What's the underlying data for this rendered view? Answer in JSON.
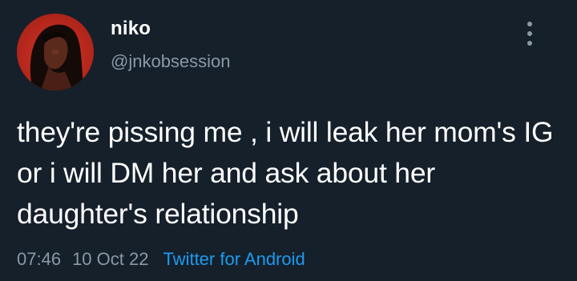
{
  "tweet": {
    "author": {
      "display_name": "niko",
      "handle": "@jnkobsession",
      "avatar_icon": "profile-photo"
    },
    "more_icon": "vertical-ellipsis-icon",
    "text": "they're pissing me , i will leak her mom's IG or i will DM her and ask about her daughter's relationship",
    "time": "07:46",
    "date": "10 Oct 22",
    "source": "Twitter for Android"
  },
  "colors": {
    "background": "#15202b",
    "primary_text": "#ffffff",
    "secondary_text": "#8b98a5",
    "link": "#1d9bf0",
    "avatar_bg": "#c3301f"
  }
}
